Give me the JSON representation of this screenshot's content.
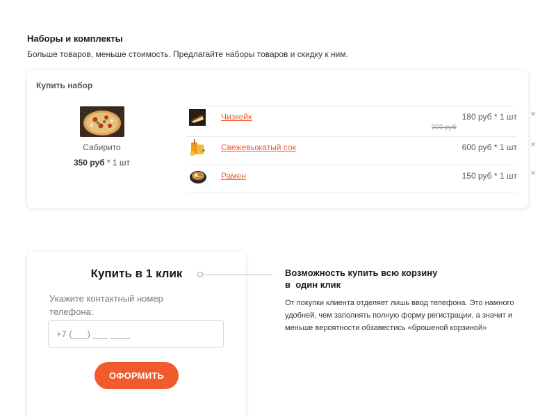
{
  "sets_section": {
    "title": "Наборы и комплекты",
    "subtitle": "Больше товаров, меньше стоимость. Предлагайте наборы товаров и скидку к ним."
  },
  "set_card": {
    "title": "Купить набор",
    "main_product": {
      "name": "Сабирито",
      "price": "350 руб",
      "quantity": "* 1 шт",
      "image_icon": "pizza-image"
    },
    "items": [
      {
        "name": "Чизкейк",
        "price": "180 руб * 1 шт",
        "old_price": "200 руб",
        "thumb_icon": "cheesecake-image",
        "remove": "×"
      },
      {
        "name": "Свежевыжатый сок",
        "price": "600 руб * 1 шт",
        "old_price": "",
        "thumb_icon": "juice-image",
        "remove": "×"
      },
      {
        "name": "Рамен",
        "price": "150 руб * 1 шт",
        "old_price": "",
        "thumb_icon": "ramen-image",
        "remove": "×"
      }
    ]
  },
  "oneclick": {
    "title": "Купить в 1 клик",
    "label": "Укажите контактный номер телефона:",
    "phone_placeholder": "+7 (___) ___ ____",
    "submit_label": "ОФОРМИТЬ"
  },
  "feature": {
    "title_line1": "Возможность купить всю корзину",
    "title_line2": "в  один клик",
    "text": "От покупки клиента отделяет лишь ввод телефона. Это намного удобней, чем заполнять полную форму регистрации, а значит и  меньше вероятности обзавестись «брошеной корзиной»"
  },
  "colors": {
    "accent": "#f15a2b",
    "link": "#ef5a2a",
    "connector": "#b8c2cc"
  }
}
